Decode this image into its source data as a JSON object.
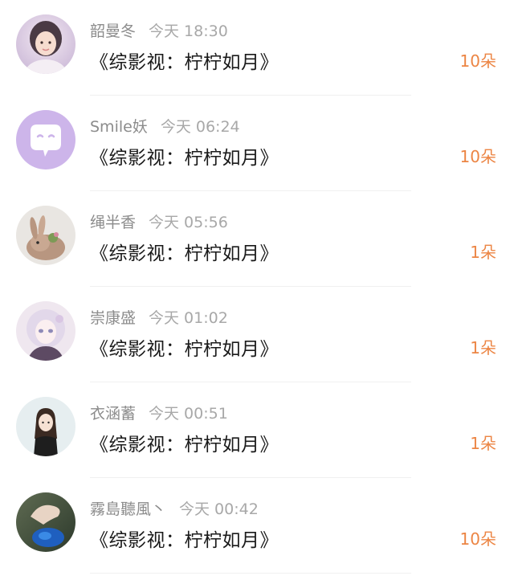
{
  "accent_color": "#ec8544",
  "records": [
    {
      "name": "韶曼冬",
      "time": "今天 18:30",
      "title": "《综影视：柠柠如月》",
      "count": "10朵",
      "avatar": "avatar-girl-photo"
    },
    {
      "name": "Smile妖",
      "time": "今天 06:24",
      "title": "《综影视：柠柠如月》",
      "count": "10朵",
      "avatar": "avatar-chat-bubble-icon"
    },
    {
      "name": "绳半香",
      "time": "今天 05:56",
      "title": "《综影视：柠柠如月》",
      "count": "1朵",
      "avatar": "avatar-bunny-photo"
    },
    {
      "name": "崇康盛",
      "time": "今天 01:02",
      "title": "《综影视：柠柠如月》",
      "count": "1朵",
      "avatar": "avatar-anime-girl"
    },
    {
      "name": "衣涵蓄",
      "time": "今天 00:51",
      "title": "《综影视：柠柠如月》",
      "count": "1朵",
      "avatar": "avatar-cartoon-girl"
    },
    {
      "name": "霧島聽風丶",
      "time": "今天 00:42",
      "title": "《综影视：柠柠如月》",
      "count": "10朵",
      "avatar": "avatar-hand-photo"
    }
  ]
}
